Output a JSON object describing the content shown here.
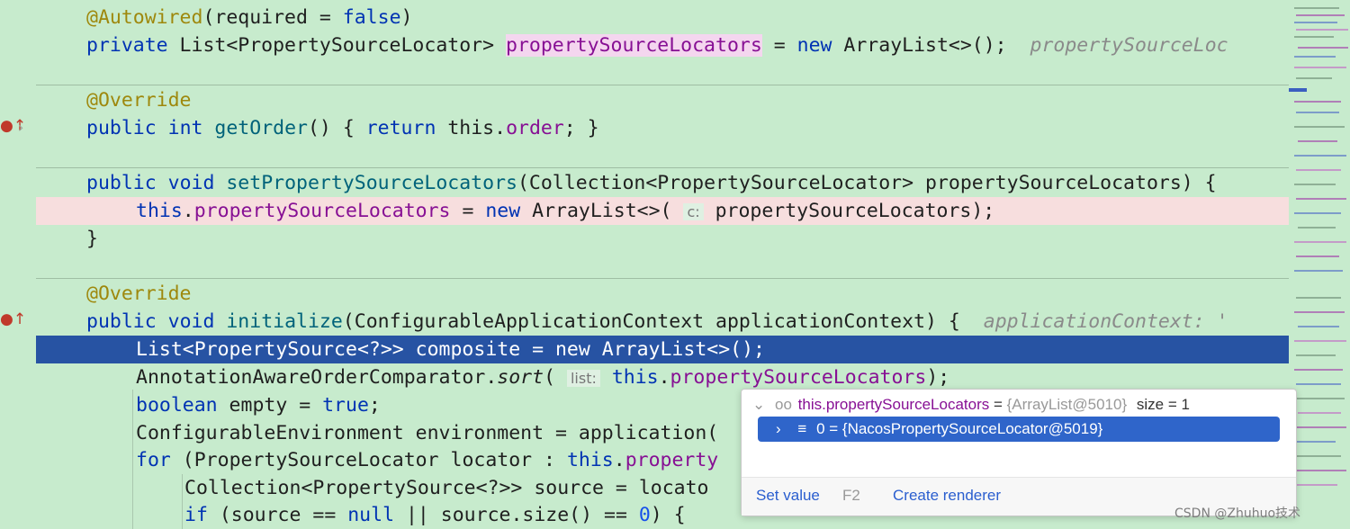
{
  "gutter": {
    "override_marker": "●↑",
    "fold_arrow": "›"
  },
  "code": {
    "l1": {
      "ann": "@Autowired",
      "rest": "(required = ",
      "kw": "false",
      "end": ")"
    },
    "l2": {
      "kw": "private",
      "type": " List<PropertySourceLocator> ",
      "field": "propertySourceLocators",
      "eq": " = ",
      "kw_new": "new",
      "rest": " ArrayList<>();",
      "hint": "  propertySourceLoc"
    },
    "l3": {
      "ann": "@Override"
    },
    "l4": {
      "kw1": "public",
      "kw2": "int",
      "fn": "getOrder",
      "p": "() ",
      "b1": "{ ",
      "kw3": "return",
      "t": " this.",
      "field": "order",
      "end": "; }"
    },
    "l5": {
      "kw1": "public",
      "kw2": "void",
      "fn": "setPropertySourceLocators",
      "rest": "(Collection<PropertySourceLocator> propertySourceLocators) {"
    },
    "l6": {
      "kw": "this",
      "dot": ".",
      "field": "propertySourceLocators",
      "eq": " = ",
      "kw_new": "new",
      "rest": " ArrayList<>(",
      "hint_label": "c:",
      "arg": " propertySourceLocators);"
    },
    "l7": {
      "text": "}"
    },
    "l8": {
      "ann": "@Override"
    },
    "l9": {
      "kw1": "public",
      "kw2": "void",
      "fn": "initialize",
      "rest": "(ConfigurableApplicationContext applicationContext) {",
      "hint": "  applicationContext: '"
    },
    "l10": {
      "text": "List<PropertySource<?>> composite = new ArrayList<>();"
    },
    "l11": {
      "cls": "AnnotationAwareOrderComparator.",
      "fn": "sort",
      "p": "(",
      "hint_label": "list:",
      "kw": "this",
      "dot": ".",
      "field": "propertySourceLocators",
      "end": ");"
    },
    "l12": {
      "kw": "boolean",
      "rest": " empty = ",
      "kw2": "true",
      "end": ";"
    },
    "l13": {
      "text": "ConfigurableEnvironment environment = application("
    },
    "l14": {
      "kw": "for",
      "rest": " (PropertySourceLocator locator : ",
      "kw2": "this",
      "dot": ".",
      "field": "property"
    },
    "l15": {
      "text": "Collection<PropertySource<?>> source = locato"
    },
    "l16": {
      "kw": "if",
      "rest": " (source == ",
      "kw2": "null",
      "rest2": " || source.size() == ",
      "num": "0",
      "end": ") {"
    }
  },
  "popup": {
    "expand_icon": "⌄",
    "watch_icon": "oo",
    "var_name": "this.propertySourceLocators",
    "var_eq": " = ",
    "var_value": "{ArrayList@5010}",
    "var_size": "size = 1",
    "child_arrow": "›",
    "child_icon": "≡",
    "child_text": "0 = {NacosPropertySourceLocator@5019}",
    "set_value": "Set value",
    "shortcut": "F2",
    "create_renderer": "Create renderer"
  },
  "watermark": "CSDN @Zhuhuo技术"
}
